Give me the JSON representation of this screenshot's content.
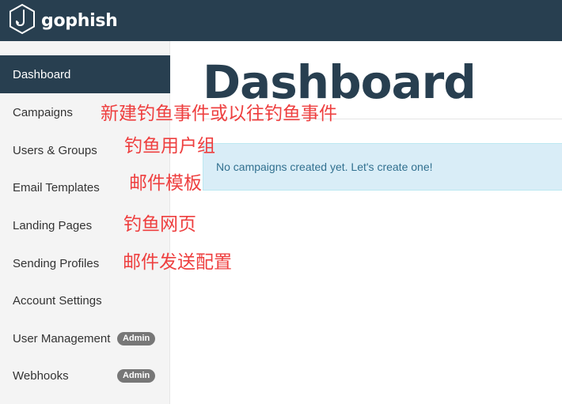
{
  "brand": {
    "name": "gophish"
  },
  "sidebar": {
    "items": [
      {
        "label": "Dashboard",
        "active": true
      },
      {
        "label": "Campaigns"
      },
      {
        "label": "Users & Groups"
      },
      {
        "label": "Email Templates"
      },
      {
        "label": "Landing Pages"
      },
      {
        "label": "Sending Profiles"
      },
      {
        "label": "Account Settings"
      },
      {
        "label": "User Management",
        "badge": "Admin"
      },
      {
        "label": "Webhooks",
        "badge": "Admin"
      }
    ]
  },
  "main": {
    "title": "Dashboard",
    "alert": "No campaigns created yet. Let's create one!"
  },
  "annotations": {
    "campaigns": "新建钓鱼事件或以往钓鱼事件",
    "users_groups": "钓鱼用户组",
    "email_templates": "邮件模板",
    "landing_pages": "钓鱼网页",
    "sending_profiles": "邮件发送配置"
  },
  "colors": {
    "navbar": "#283f50",
    "active_item": "#283f50",
    "alert_bg": "#d9edf7",
    "annotation": "#ee3f3f",
    "badge": "#777777"
  },
  "icons": {
    "logo": "hook-hexagon-icon"
  }
}
